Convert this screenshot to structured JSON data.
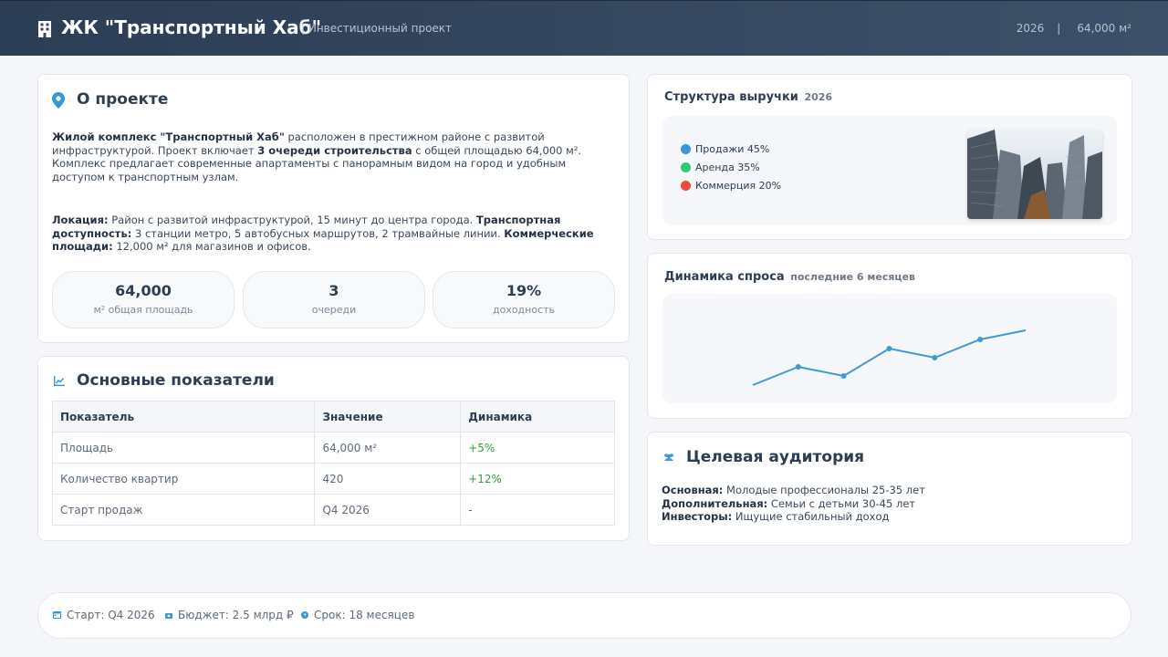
{
  "header": {
    "title": "ЖК \"Транспортный Хаб\"",
    "subtitle": "| Инвестиционный проект",
    "year": "2026",
    "separator": "|",
    "area": "64,000 м²"
  },
  "about": {
    "heading": "О проекте",
    "p1": {
      "b1": "Жилой комплекс \"Транспортный Хаб\"",
      "t1": " расположен в престижном районе с развитой инфраструктурой. Проект включает ",
      "b2": "3 очереди строительства",
      "t2": " с общей площадью 64,000 м². Комплекс предлагает современные апартаменты с панорамным видом на город и удобным доступом к транспортным узлам."
    },
    "p2": {
      "b1": "Локация:",
      "t1": " Район с развитой инфраструктурой, 15 минут до центра города. ",
      "b2": "Транспортная доступность:",
      "t2": " 3 станции метро, 5 автобусных маршрутов, 2 трамвайные линии. ",
      "b3": "Коммерческие площади:",
      "t3": " 12,000 м² для магазинов и офисов."
    },
    "stats": [
      {
        "value": "64,000",
        "label": "м² общая площадь"
      },
      {
        "value": "3",
        "label": "очереди"
      },
      {
        "value": "19%",
        "label": "доходность"
      }
    ]
  },
  "metrics": {
    "heading": "Основные показатели",
    "columns": [
      "Показатель",
      "Значение",
      "Динамика"
    ],
    "rows": [
      [
        "Площадь",
        "64,000 м²",
        "+5%"
      ],
      [
        "Количество квартир",
        "420",
        "+12%"
      ],
      [
        "Старт продаж",
        "Q4 2026",
        "-"
      ]
    ]
  },
  "revenue": {
    "heading": "Структура выручки",
    "badge": "2026",
    "items": [
      {
        "label": "Продажи 45%",
        "color": "#3498db"
      },
      {
        "label": "Аренда 35%",
        "color": "#2ecc71"
      },
      {
        "label": "Коммерция 20%",
        "color": "#e74c3c"
      }
    ]
  },
  "demand": {
    "heading": "Динамика спроса",
    "badge": "последние 6 месяцев"
  },
  "chart_data": {
    "type": "line",
    "title": "Динамика спроса",
    "subtitle": "последние 6 месяцев",
    "values": [
      10,
      30,
      20,
      50,
      40,
      60,
      70
    ],
    "ylim": [
      0,
      100
    ],
    "grid": false,
    "color": "#3d9bd6"
  },
  "audience": {
    "heading": "Целевая аудитория",
    "rows": [
      {
        "label": "Основная:",
        "text": " Молодые профессионалы 25-35 лет"
      },
      {
        "label": "Дополнительная:",
        "text": " Семьи с детьми 30-45 лет"
      },
      {
        "label": "Инвесторы:",
        "text": " Ищущие стабильный доход"
      }
    ]
  },
  "footer": {
    "start": "Старт: Q4 2026",
    "budget": "Бюджет: 2.5 млрд ₽",
    "term": "Срок: 18 месяцев"
  },
  "colors": {
    "header_bg": "#2c3e55",
    "accent": "#3498db",
    "positive": "#2e9e3e"
  },
  "icons": [
    "building-icon",
    "map-pin-icon",
    "line-chart-icon",
    "users-icon",
    "calendar-icon",
    "money-icon",
    "clock-icon"
  ]
}
